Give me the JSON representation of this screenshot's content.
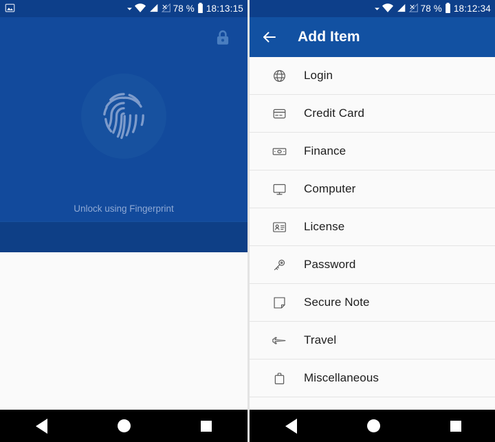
{
  "left_panel": {
    "status_bar": {
      "notification_icon": "image-icon",
      "wifi_icon": "wifi-icon",
      "signal_icon": "signal-icon",
      "no_sim_icon": "no-sim-icon",
      "battery_percent": "78 %",
      "battery_icon": "battery-icon",
      "time": "18:13:15"
    },
    "lock_badge_icon": "lock-icon",
    "fingerprint_icon": "fingerprint-icon",
    "hint_text": "Unlock using Fingerprint",
    "nav": {
      "back": "back-nav-button",
      "home": "home-nav-button",
      "recents": "recents-nav-button"
    }
  },
  "right_panel": {
    "status_bar": {
      "wifi_icon": "wifi-icon",
      "signal_icon": "signal-icon",
      "no_sim_icon": "no-sim-icon",
      "battery_percent": "78 %",
      "battery_icon": "battery-icon",
      "time": "18:12:34"
    },
    "appbar": {
      "back_icon": "arrow-left-icon",
      "title": "Add Item"
    },
    "items": [
      {
        "label": "Login",
        "icon": "globe-icon"
      },
      {
        "label": "Credit Card",
        "icon": "credit-card-icon"
      },
      {
        "label": "Finance",
        "icon": "banknote-icon"
      },
      {
        "label": "Computer",
        "icon": "monitor-icon"
      },
      {
        "label": "License",
        "icon": "id-card-icon"
      },
      {
        "label": "Password",
        "icon": "key-icon"
      },
      {
        "label": "Secure Note",
        "icon": "note-icon"
      },
      {
        "label": "Travel",
        "icon": "airplane-icon"
      },
      {
        "label": "Miscellaneous",
        "icon": "briefcase-icon"
      }
    ],
    "nav": {
      "back": "back-nav-button",
      "home": "home-nav-button",
      "recents": "recents-nav-button"
    }
  },
  "colors": {
    "primary_blue": "#124a9c",
    "status_bar_blue": "#0d3f8a",
    "appbar_blue": "#1251a2",
    "band_blue": "#0e3f86",
    "list_bg": "#fafafa",
    "divider": "#e4e4e4",
    "hint_text": "#8fa9d4",
    "icon_gray": "#5a5a5a",
    "nav_bg": "#000000"
  }
}
